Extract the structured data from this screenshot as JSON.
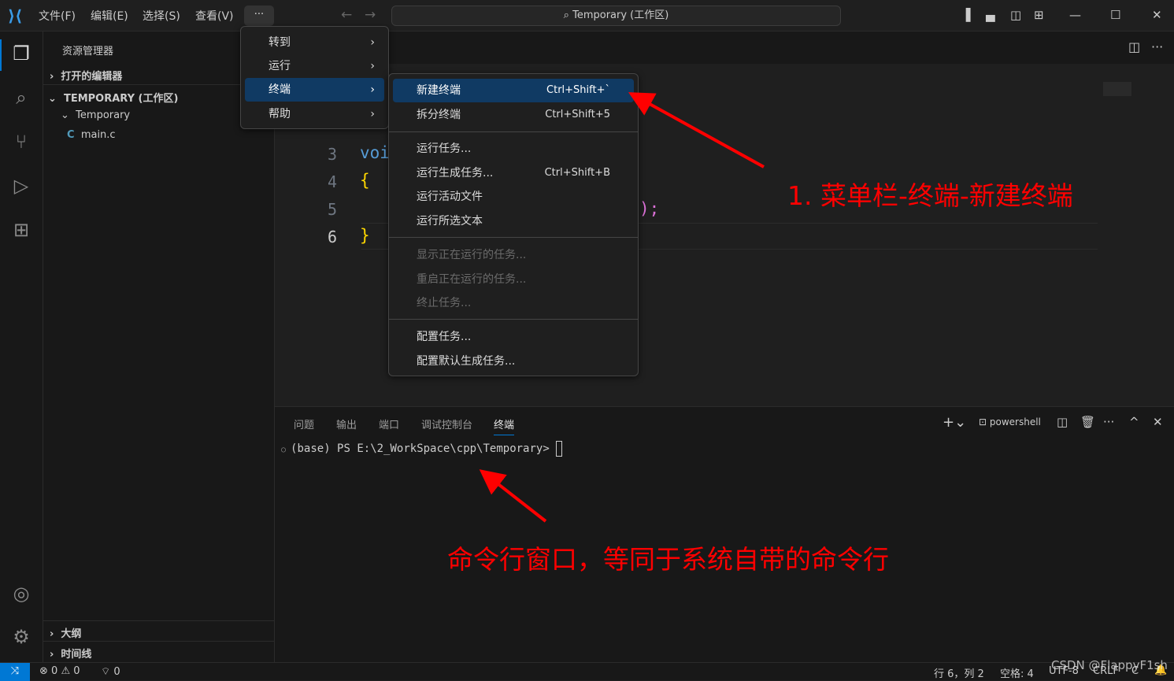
{
  "titlebar": {
    "menus": [
      "文件(F)",
      "编辑(E)",
      "选择(S)",
      "查看(V)"
    ],
    "more": "···",
    "search": "Temporary (工作区)"
  },
  "sidebar": {
    "title": "资源管理器",
    "open_editors": "打开的编辑器",
    "workspace": "TEMPORARY (工作区)",
    "folder": "Temporary",
    "file": "main.c",
    "file_icon": "C",
    "outline": "大纲",
    "timeline": "时间线"
  },
  "editor": {
    "lines": [
      "3",
      "4",
      "5",
      "6"
    ],
    "code": [
      "voi",
      "{",
      "",
      "}"
    ],
    "code_tail": ");"
  },
  "menu": {
    "items": [
      "转到",
      "运行",
      "终端",
      "帮助"
    ]
  },
  "submenu": {
    "items": [
      {
        "label": "新建终端",
        "kb": "Ctrl+Shift+`"
      },
      {
        "label": "拆分终端",
        "kb": "Ctrl+Shift+5"
      },
      {
        "label": "运行任务..."
      },
      {
        "label": "运行生成任务...",
        "kb": "Ctrl+Shift+B"
      },
      {
        "label": "运行活动文件"
      },
      {
        "label": "运行所选文本"
      },
      {
        "label": "显示正在运行的任务..."
      },
      {
        "label": "重启正在运行的任务..."
      },
      {
        "label": "终止任务..."
      },
      {
        "label": "配置任务..."
      },
      {
        "label": "配置默认生成任务..."
      }
    ]
  },
  "panel": {
    "tabs": [
      "问题",
      "输出",
      "端口",
      "调试控制台",
      "终端"
    ],
    "active_tab": "终端",
    "shell": "powershell",
    "prompt": "(base) PS E:\\2_WorkSpace\\cpp\\Temporary>"
  },
  "status": {
    "errors": "0",
    "warnings": "0",
    "ports": "0",
    "position": "行 6，列 2",
    "spaces": "空格: 4",
    "encoding": "UTF-8",
    "eol": "CRLF",
    "lang": "C"
  },
  "annotations": {
    "a1": "1. 菜单栏-终端-新建终端",
    "a2": "命令行窗口，等同于系统自带的命令行"
  },
  "watermark": "CSDN @FlappyF1sh",
  "colors": {
    "accent": "#0078d4",
    "menu_selected": "#103a63",
    "annotation": "#ff0000"
  }
}
